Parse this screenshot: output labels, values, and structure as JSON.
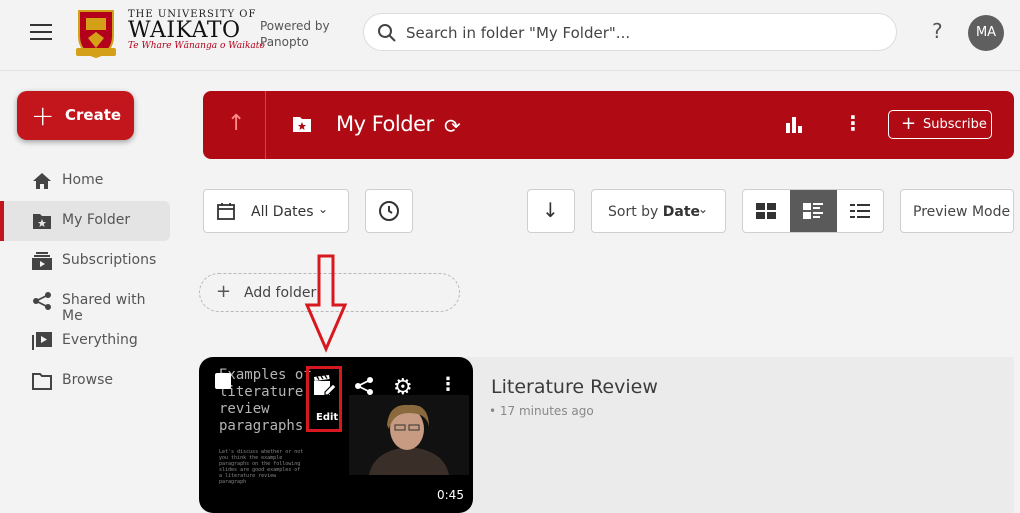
{
  "header": {
    "university_line1": "THE UNIVERSITY OF",
    "university_line2": "WAIKATO",
    "motto": "Te Whare Wānanga o Waikato",
    "powered_by": "Powered by Panopto",
    "search_placeholder": "Search in folder \"My Folder\"...",
    "help": "?",
    "avatar_initials": "MA"
  },
  "sidebar": {
    "create_label": "Create",
    "items": [
      {
        "label": "Home",
        "icon": "home-icon"
      },
      {
        "label": "My Folder",
        "icon": "star-folder-icon",
        "active": true
      },
      {
        "label": "Subscriptions",
        "icon": "subscriptions-icon"
      },
      {
        "label": "Shared with Me",
        "icon": "share-icon"
      },
      {
        "label": "Everything",
        "icon": "play-library-icon"
      },
      {
        "label": "Browse",
        "icon": "folder-icon"
      }
    ]
  },
  "folder_header": {
    "title": "My Folder",
    "subscribe_label": "Subscribe"
  },
  "toolbar": {
    "dates_label": "All Dates",
    "sort_prefix": "Sort by",
    "sort_value": "Date",
    "preview_label": "Preview Mode",
    "active_view": "detail"
  },
  "add_folder_label": "Add folder",
  "session": {
    "title": "Literature Review",
    "time_ago": "17 minutes ago",
    "duration": "0:45",
    "thumb_text": "Examples of\nliterature\nreview\nparagraphs",
    "thumb_small": "Let's discuss whether or not\nyou think the example\nparagraphs on the following\nslides are good examples of\na literature review\nparagraph",
    "edit_label": "Edit"
  },
  "colors": {
    "brand_red": "#b00b14",
    "create_red": "#c2151c",
    "annotation_red": "#d8181f"
  }
}
